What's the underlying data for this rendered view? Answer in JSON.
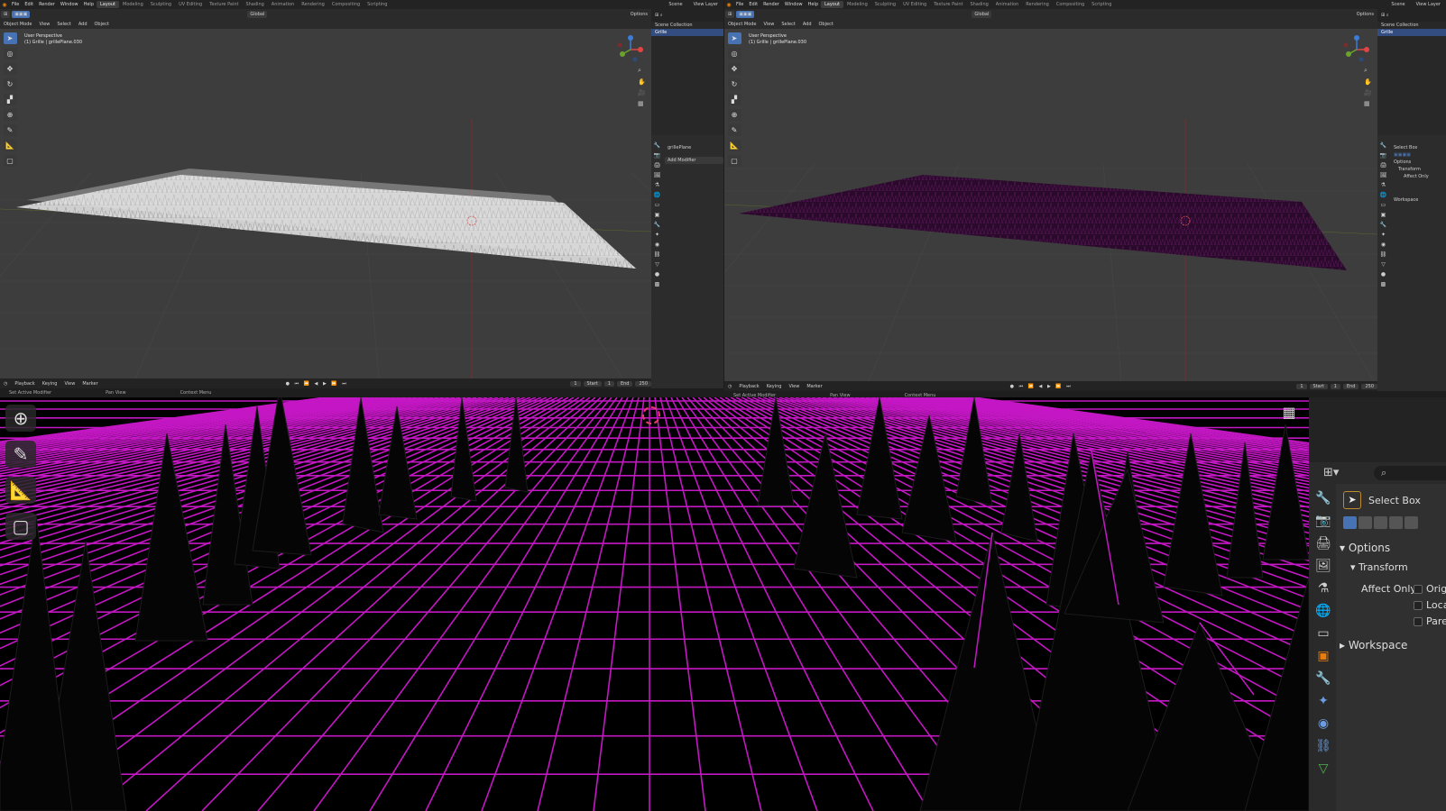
{
  "topbar": {
    "menus": [
      "File",
      "Edit",
      "Render",
      "Window",
      "Help"
    ],
    "workspaces": [
      "Layout",
      "Modeling",
      "Sculpting",
      "UV Editing",
      "Texture Paint",
      "Shading",
      "Animation",
      "Rendering",
      "Compositing",
      "Scripting"
    ],
    "active_workspace": "Layout",
    "scene": "Scene",
    "view_layer": "View Layer"
  },
  "viewport_header": {
    "mode": "Object Mode",
    "menus": [
      "View",
      "Select",
      "Add",
      "Object"
    ],
    "orientation": "Global",
    "options": "Options"
  },
  "viewport_left": {
    "view_name": "User Perspective",
    "object_info": "(1) Grille | grillePlane.030"
  },
  "viewport_right": {
    "view_name": "User Perspective",
    "object_info": "(1) Grille | grillePlane.030"
  },
  "outliner_left": {
    "title": "Scene Collection",
    "items": [
      "Grille"
    ]
  },
  "outliner_right": {
    "title": "Scene Collection",
    "items": [
      "Grille"
    ]
  },
  "properties_left": {
    "object": "grillePlane",
    "add_modifier": "Add Modifier"
  },
  "properties_right": {
    "tool": "Select Box",
    "options": "Options",
    "transform": "Transform",
    "affect_only": "Affect Only",
    "workspace": "Workspace"
  },
  "timeline": {
    "menus": [
      "Playback",
      "Keying",
      "View",
      "Marker"
    ],
    "current_frame": "1",
    "start_label": "Start",
    "start": "1",
    "end_label": "End",
    "end": "250"
  },
  "statusbar": {
    "items": [
      "Set Active Modifier",
      "Pan View",
      "Context Menu"
    ]
  },
  "bottom_panel": {
    "tool": "Select Box",
    "options": "Options",
    "transform": "Transform",
    "affect_only": "Affect Only",
    "checkbox_labels": [
      "Orig",
      "Loca",
      "Pare"
    ],
    "workspace": "Workspace"
  },
  "colors": {
    "grid": "#c417c4",
    "accent_blue": "#4772b3",
    "bg": "#3d3d3d"
  }
}
